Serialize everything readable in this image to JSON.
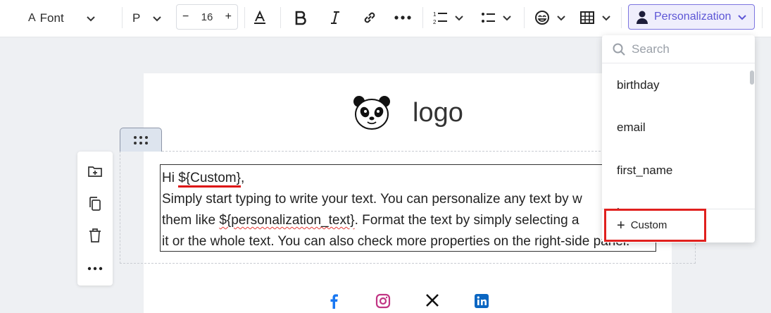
{
  "toolbar": {
    "font_label": "Font",
    "font_icon_text": "A",
    "paragraph_label": "P",
    "font_size": "16",
    "decrement": "−",
    "increment": "+",
    "personalization_label": "Personalization"
  },
  "logo": {
    "text": "logo"
  },
  "editor": {
    "line1_pre": "Hi ",
    "line1_var": "${Custom}",
    "line1_post": ",",
    "line2": "Simply start typing to write your text. You can personalize any text by w",
    "line3_pre": "them like ",
    "line3_var": "${personalization_text}",
    "line3_post": ". Format the text by simply selecting a",
    "line4": "it or the whole text. You can also check more properties on the right-side panel."
  },
  "dropdown": {
    "search_placeholder": "Search",
    "items": [
      "birthday",
      "email",
      "first_name",
      "last_name"
    ],
    "custom_label": "Custom",
    "custom_plus": "+"
  },
  "social": [
    "facebook",
    "instagram",
    "x",
    "linkedin"
  ],
  "colors": {
    "accent": "#5d56d6",
    "accent_bg": "#efeefc",
    "highlight_red": "#e0201e",
    "facebook": "#1877f2",
    "instagram": "#c13584",
    "linkedin": "#0a66c2"
  }
}
